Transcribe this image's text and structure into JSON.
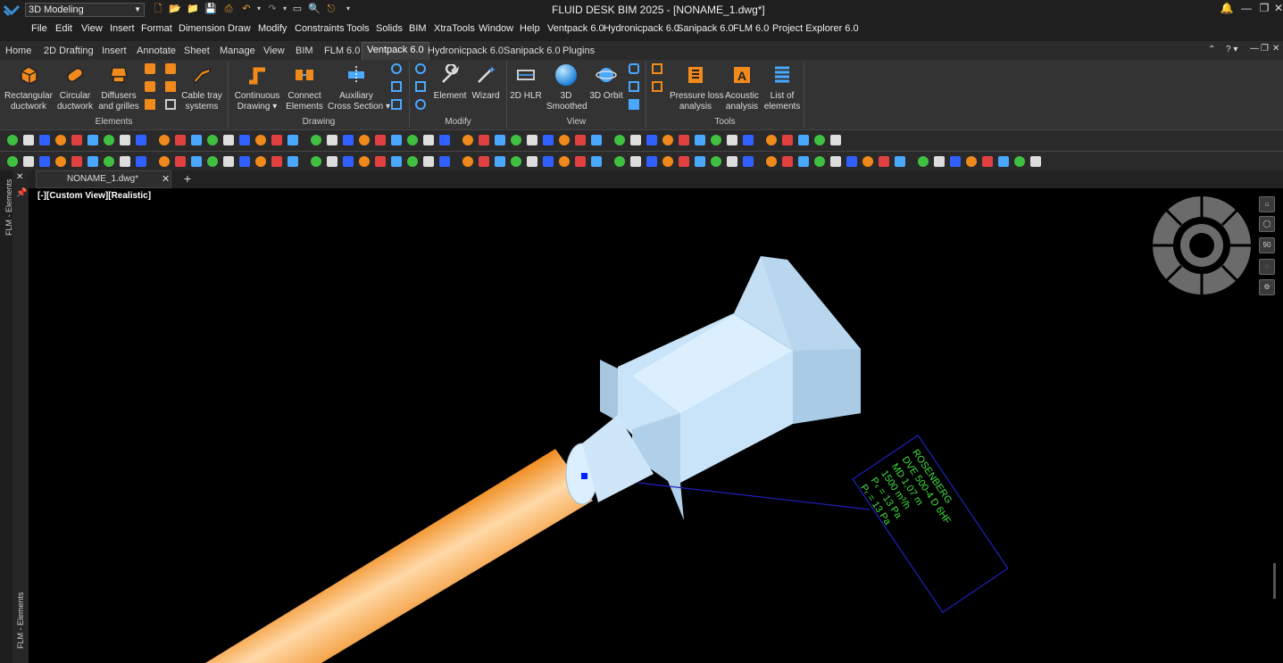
{
  "app": {
    "title": "FLUID DESK BIM 2025 - [NONAME_1.dwg*]",
    "workspace": "3D Modeling"
  },
  "menu": [
    "File",
    "Edit",
    "View",
    "Insert",
    "Format",
    "Dimension",
    "Draw",
    "Modify",
    "Constraints",
    "Tools",
    "Solids",
    "BIM",
    "XtraTools",
    "Window",
    "Help",
    "Ventpack 6.0",
    "Hydronicpack 6.0",
    "Sanipack 6.0",
    "FLM 6.0",
    "Project Explorer 6.0"
  ],
  "ribbon_tabs": [
    "Home",
    "2D Drafting",
    "Insert",
    "Annotate",
    "Sheet",
    "Manage",
    "View",
    "BIM",
    "FLM 6.0",
    "Ventpack 6.0",
    "Hydronicpack 6.0",
    "Sanipack 6.0",
    "Plugins"
  ],
  "ribbon_active_tab": "Ventpack 6.0",
  "groups": {
    "elements": {
      "label": "Elements",
      "buttons": [
        {
          "l1": "Rectangular",
          "l2": "ductwork"
        },
        {
          "l1": "Circular",
          "l2": "ductwork"
        },
        {
          "l1": "Diffusers",
          "l2": "and grilles"
        },
        {
          "l1": "Cable tray",
          "l2": "systems"
        }
      ]
    },
    "drawing": {
      "label": "Drawing",
      "buttons": [
        {
          "l1": "Continuous",
          "l2": "Drawing ▾"
        },
        {
          "l1": "Connect",
          "l2": "Elements"
        },
        {
          "l1": "Auxiliary",
          "l2": "Cross Section ▾"
        }
      ]
    },
    "modify": {
      "label": "Modify",
      "buttons": [
        {
          "l1": "Element",
          "l2": ""
        },
        {
          "l1": "Wizard",
          "l2": ""
        }
      ]
    },
    "view": {
      "label": "View",
      "buttons": [
        {
          "l1": "2D HLR",
          "l2": ""
        },
        {
          "l1": "3D",
          "l2": "Smoothed"
        },
        {
          "l1": "3D Orbit",
          "l2": ""
        }
      ]
    },
    "tools": {
      "label": "Tools",
      "buttons": [
        {
          "l1": "Pressure loss",
          "l2": "analysis"
        },
        {
          "l1": "Acoustic",
          "l2": "analysis"
        },
        {
          "l1": "List of",
          "l2": "elements"
        }
      ]
    }
  },
  "document_tab": "NONAME_1.dwg*",
  "side_panel_label": "FLM - Elements",
  "viewport_label": "[-][Custom View][Realistic]",
  "viewcube_value": "90",
  "annotation": {
    "lines": [
      "ROSENBERG",
      "DVE 500-4 D 6HF",
      "MD 1,07 m",
      "1500 m³/h",
      "Pₛ = 13 Pa",
      "Pₜ = 13 Pa"
    ]
  },
  "colors": {
    "duct": "#f08a1c",
    "fan": "#c9e4f8",
    "annotation_text": "#40e040",
    "annotation_border": "#2020c0"
  }
}
